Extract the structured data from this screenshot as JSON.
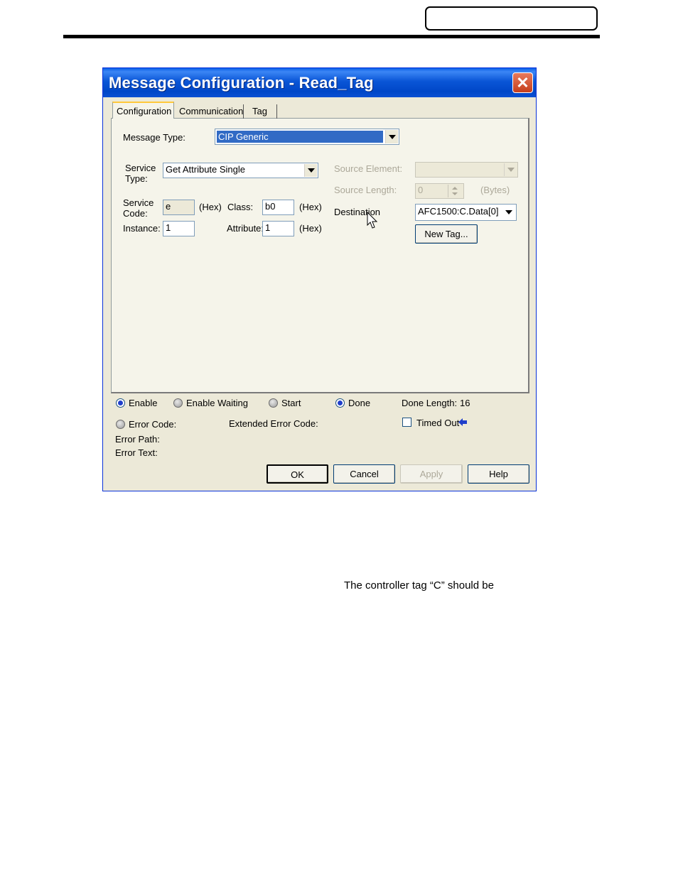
{
  "window": {
    "title": "Message Configuration - Read_Tag",
    "close_symbol": "✕"
  },
  "tabs": [
    {
      "label": "Configuration",
      "active": true
    },
    {
      "label": "Communication",
      "active": false
    },
    {
      "label": "Tag",
      "active": false
    }
  ],
  "config": {
    "message_type_label": "Message Type:",
    "message_type_value": "CIP Generic",
    "service_type_label_1": "Service",
    "service_type_label_2": "Type:",
    "service_type_value": "Get Attribute Single",
    "service_code_label_1": "Service",
    "service_code_label_2": "Code:",
    "service_code_value": "e",
    "hex_label": "(Hex)",
    "class_label": "Class:",
    "class_value": "b0",
    "instance_label": "Instance:",
    "instance_value": "1",
    "attribute_label": "Attribute:",
    "attribute_value": "1",
    "source_element_label": "Source Element:",
    "source_element_value": "",
    "source_length_label": "Source Length:",
    "source_length_value": "0",
    "bytes_label": "(Bytes)",
    "destination_label": "Destination",
    "destination_value": "AFC1500:C.Data[0]",
    "new_tag_label": "New Tag..."
  },
  "status": {
    "enable": {
      "label": "Enable",
      "on": true
    },
    "enable_waiting": {
      "label": "Enable Waiting",
      "on": false
    },
    "start": {
      "label": "Start",
      "on": false
    },
    "done": {
      "label": "Done",
      "on": true
    },
    "done_length_label": "Done Length:",
    "done_length_value": "16",
    "error_code_label": "Error Code:",
    "extended_error_code_label": "Extended Error Code:",
    "timed_out_label": "Timed Out",
    "timed_out_checked": false,
    "error_path_label": "Error Path:",
    "error_text_label": "Error Text:"
  },
  "buttons": {
    "ok": "OK",
    "cancel": "Cancel",
    "apply": "Apply",
    "help": "Help"
  },
  "document": {
    "fragment_text": "The  controller  tag  “C”  should  be"
  },
  "colors": {
    "title_bar": "#0a55d6",
    "dialog_bg": "#ece9d8",
    "selection": "#316ac5",
    "close_button": "#c63f1c"
  }
}
